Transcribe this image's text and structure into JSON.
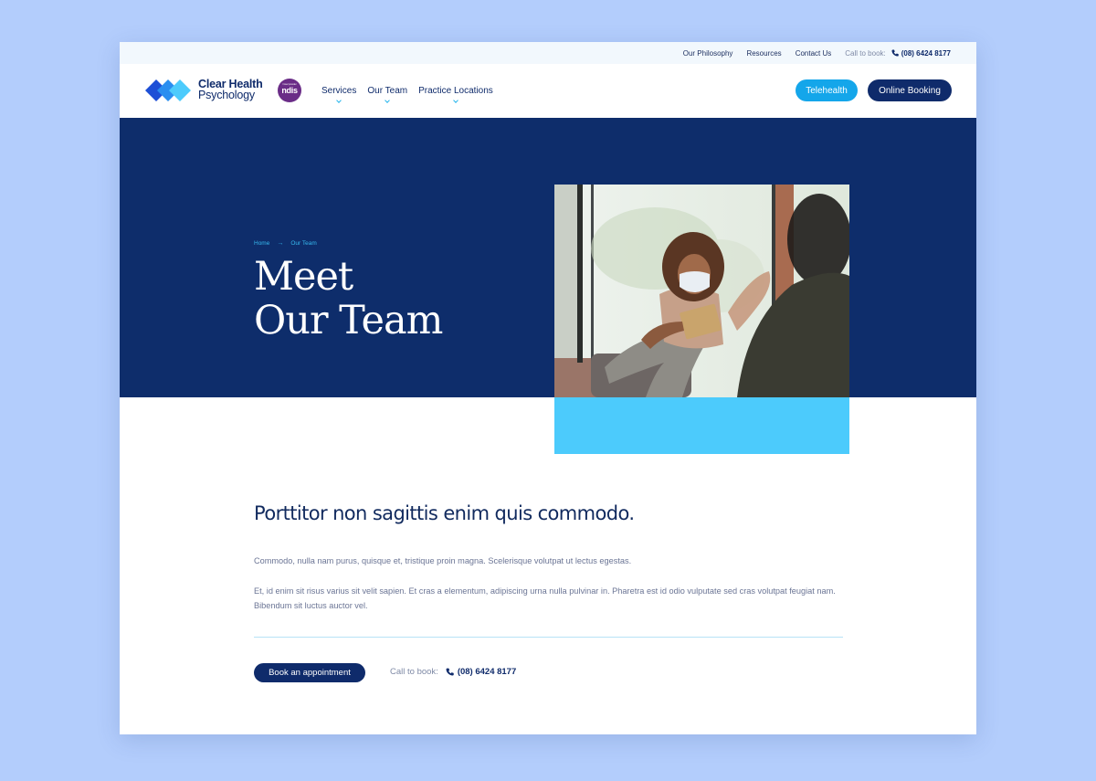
{
  "utility_bar": {
    "links": [
      "Our Philosophy",
      "Resources",
      "Contact Us"
    ],
    "call_label": "Call to book:",
    "phone": "(08) 6424 8177"
  },
  "header": {
    "brand_line1": "Clear Health",
    "brand_line2": "Psychology",
    "ndis_small": "I love/ provider",
    "ndis_label": "ndis",
    "nav": [
      {
        "label": "Services",
        "has_dropdown": true
      },
      {
        "label": "Our Team",
        "has_dropdown": true
      },
      {
        "label": "Practice Locations",
        "has_dropdown": true
      }
    ],
    "telehealth_label": "Telehealth",
    "booking_label": "Online Booking"
  },
  "hero": {
    "breadcrumb_home": "Home",
    "breadcrumb_current": "Our Team",
    "title_line1": "Meet",
    "title_line2": "Our Team",
    "photo_icon": "masked-psychologist-photo"
  },
  "content": {
    "lead": "Porttitor non sagittis enim quis commodo.",
    "paragraph1": "Commodo, nulla nam purus, quisque et, tristique proin magna. Scelerisque volutpat ut lectus egestas.",
    "paragraph2": "Et, id enim sit risus varius sit velit sapien. Et cras a elementum, adipiscing urna nulla pulvinar in. Pharetra est id odio vulputate sed cras volutpat feugiat nam. Bibendum sit luctus auctor vel.",
    "appointment_label": "Book an appointment",
    "call_label": "Call to book:",
    "phone": "(08) 6424 8177"
  },
  "colors": {
    "navy": "#0e2d6b",
    "accent_blue": "#14a6ea",
    "cyan_block": "#4ccbfc",
    "page_backdrop": "#b3cdfc"
  }
}
